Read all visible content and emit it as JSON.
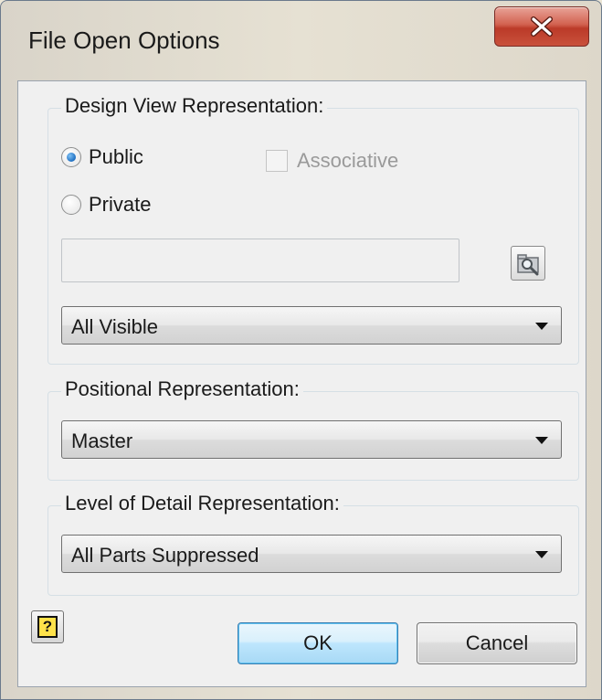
{
  "window": {
    "title": "File Open Options",
    "close_symbol": "X"
  },
  "design_view": {
    "label": "Design View Representation:",
    "public_label": "Public",
    "private_label": "Private",
    "associative_label": "Associative",
    "public_selected": true,
    "associative_checked": false,
    "path_value": "",
    "selected": "All Visible"
  },
  "positional": {
    "label": "Positional Representation:",
    "selected": "Master"
  },
  "level_of_detail": {
    "label": "Level of Detail Representation:",
    "selected": "All Parts Suppressed"
  },
  "buttons": {
    "help_symbol": "?",
    "ok": "OK",
    "cancel": "Cancel"
  },
  "icons": {
    "close": "close-icon",
    "browse": "folder-search-icon",
    "help": "help-icon"
  }
}
